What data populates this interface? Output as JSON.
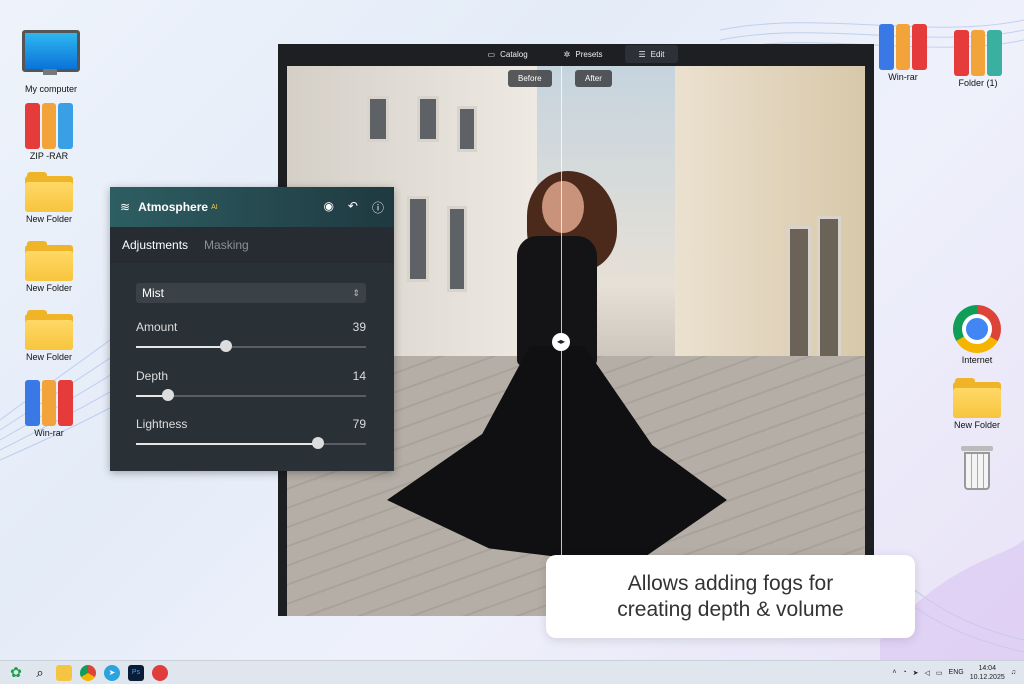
{
  "desktop": {
    "left_icons": [
      {
        "label": "My computer",
        "icon": "computer-icon"
      },
      {
        "label": "ZIP -RAR",
        "icon": "winrar-icon"
      },
      {
        "label": "New Folder",
        "icon": "folder-icon"
      },
      {
        "label": "New Folder",
        "icon": "folder-icon"
      },
      {
        "label": "New Folder",
        "icon": "folder-icon"
      },
      {
        "label": "Win-rar",
        "icon": "winrar-icon"
      }
    ],
    "right_icons": [
      {
        "label": "Win-rar",
        "icon": "winrar-icon"
      },
      {
        "label": "Folder (1)",
        "icon": "winrar-icon"
      },
      {
        "label": "Internet",
        "icon": "chrome-icon"
      },
      {
        "label": "New Folder",
        "icon": "folder-icon"
      },
      {
        "label": "",
        "icon": "recycle-bin-icon"
      }
    ]
  },
  "editor": {
    "nav": {
      "catalog": "Catalog",
      "presets": "Presets",
      "edit": "Edit"
    },
    "compare": {
      "before": "Before",
      "after": "After"
    }
  },
  "panel": {
    "title": "Atmosphere",
    "badge": "AI",
    "tabs": {
      "adjustments": "Adjustments",
      "masking": "Masking"
    },
    "preset": "Mist",
    "sliders": [
      {
        "label": "Amount",
        "value": 39
      },
      {
        "label": "Depth",
        "value": 14
      },
      {
        "label": "Lightness",
        "value": 79
      }
    ]
  },
  "caption": {
    "line1": "Allows adding fogs for",
    "line2": "creating depth & volume"
  },
  "taskbar": {
    "language": "ENG",
    "time": "14:04",
    "date": "10.12.2025"
  }
}
